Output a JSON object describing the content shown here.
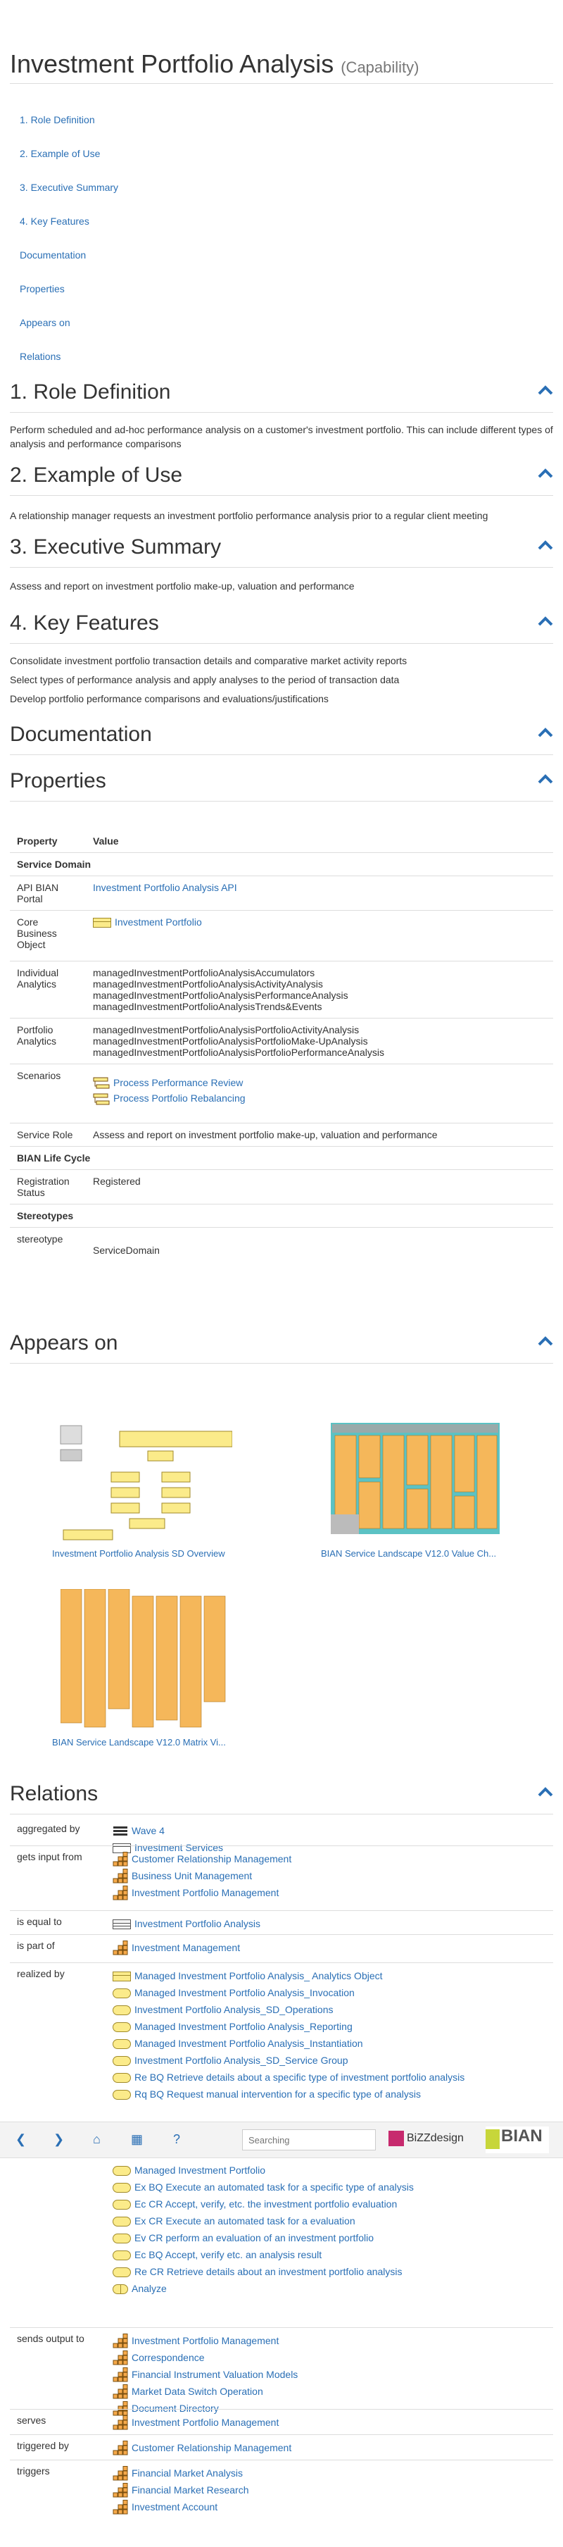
{
  "title": "Investment Portfolio Analysis",
  "title_suffix": "(Capability)",
  "toc": [
    "1. Role Definition",
    "2. Example of Use",
    "3. Executive Summary",
    "4. Key Features",
    "Documentation",
    "Properties",
    "Appears on",
    "Relations"
  ],
  "sections": {
    "role": "1. Role Definition",
    "example": "2. Example of Use",
    "exec": "3. Executive Summary",
    "features": "4. Key Features",
    "doc": "Documentation",
    "props": "Properties",
    "appears": "Appears on",
    "relations": "Relations"
  },
  "role_text": "Perform scheduled and ad-hoc performance analysis on a customer's investment portfolio. This can include different types of analysis and performance comparisons",
  "example_text": "A relationship manager requests an investment portfolio performance analysis prior to a regular client meeting",
  "exec_text": "Assess and report on investment portfolio make-up, valuation and performance",
  "features": [
    "Consolidate investment portfolio transaction details and comparative market activity reports",
    "Select types of performance analysis and apply analyses to the period of transaction data",
    "Develop portfolio performance comparisons and evaluations/justifications"
  ],
  "props": {
    "h_property": "Property",
    "h_value": "Value",
    "g_service": "Service Domain",
    "api_label": "API BIAN Portal",
    "api_value": "Investment Portfolio Analysis API",
    "cbo_label": "Core Business Object",
    "cbo_value": "Investment Portfolio",
    "ia_label": "Individual Analytics",
    "ia_values": [
      "managedInvestmentPortfolioAnalysisAccumulators",
      "managedInvestmentPortfolioAnalysisActivityAnalysis",
      "managedInvestmentPortfolioAnalysisPerformanceAnalysis",
      "managedInvestmentPortfolioAnalysisTrends&Events"
    ],
    "pa_label": "Portfolio Analytics",
    "pa_values": [
      "managedInvestmentPortfolioAnalysisPortfolioActivityAnalysis",
      "managedInvestmentPortfolioAnalysisPortfolioMake-UpAnalysis",
      "managedInvestmentPortfolioAnalysisPortfolioPerformanceAnalysis"
    ],
    "sc_label": "Scenarios",
    "sc_values": [
      "Process Performance Review",
      "Process Portfolio Rebalancing"
    ],
    "sr_label": "Service Role",
    "sr_value": "Assess and report on investment portfolio make-up, valuation and performance",
    "g_life": "BIAN Life Cycle",
    "rs_label": "Registration Status",
    "rs_value": "Registered",
    "g_stereo": "Stereotypes",
    "st_label": "stereotype",
    "st_value": "ServiceDomain"
  },
  "appears": [
    "Investment Portfolio Analysis SD Overview",
    "BIAN Service Landscape V12.0 Value Ch...",
    "BIAN Service Landscape V12.0 Matrix Vi..."
  ],
  "relations": [
    {
      "label": "aggregated by",
      "items": [
        {
          "t": "Wave 4",
          "i": "wave"
        },
        {
          "t": "Investment Services",
          "i": "plat"
        }
      ]
    },
    {
      "label": "gets input from",
      "items": [
        {
          "t": "Customer Relationship Management",
          "i": "cap"
        },
        {
          "t": "Business Unit Management",
          "i": "cap"
        },
        {
          "t": "Investment Portfolio Management",
          "i": "cap"
        }
      ]
    },
    {
      "label": "is equal to",
      "items": [
        {
          "t": "Investment Portfolio Analysis",
          "i": "table"
        }
      ]
    },
    {
      "label": "is part of",
      "items": [
        {
          "t": "Investment Management",
          "i": "cap"
        }
      ]
    },
    {
      "label": "realized by",
      "items": [
        {
          "t": "Managed Investment Portfolio Analysis_ Analytics Object",
          "i": "obj"
        },
        {
          "t": "Managed Investment Portfolio Analysis_Invocation",
          "i": "svc"
        },
        {
          "t": "Investment Portfolio Analysis_SD_Operations",
          "i": "svc"
        },
        {
          "t": "Managed Investment Portfolio Analysis_Reporting",
          "i": "svc"
        },
        {
          "t": "Managed Investment Portfolio Analysis_Instantiation",
          "i": "svc"
        },
        {
          "t": "Investment Portfolio Analysis_SD_Service Group",
          "i": "svc"
        },
        {
          "t": "Re BQ Retrieve details about a specific type of investment portfolio analysis",
          "i": "svc"
        },
        {
          "t": "Rq BQ Request manual intervention for a specific type of analysis",
          "i": "svc"
        }
      ]
    },
    {
      "label": "",
      "items": [
        {
          "t": "Managed Investment Portfolio",
          "i": "svc"
        },
        {
          "t": "Ex BQ Execute an automated task for a specific type of analysis",
          "i": "svc"
        },
        {
          "t": "Ec CR Accept, verify, etc. the investment portfolio evaluation",
          "i": "svc"
        },
        {
          "t": "Ex CR Execute an automated task for a evaluation",
          "i": "svc"
        },
        {
          "t": "Ev CR perform an evaluation of an investment portfolio",
          "i": "svc"
        },
        {
          "t": "Ec BQ Accept, verify etc. an analysis result",
          "i": "svc"
        },
        {
          "t": "Re CR Retrieve details about an investment portfolio analysis",
          "i": "svc"
        },
        {
          "t": "Analyze",
          "i": "half"
        }
      ]
    },
    {
      "label": "sends output to",
      "items": [
        {
          "t": "Investment Portfolio Management",
          "i": "cap"
        },
        {
          "t": "Correspondence",
          "i": "cap"
        },
        {
          "t": "Financial Instrument Valuation Models",
          "i": "cap"
        },
        {
          "t": "Market Data Switch Operation",
          "i": "cap"
        },
        {
          "t": "Document Directory",
          "i": "cap"
        }
      ]
    },
    {
      "label": "serves",
      "items": [
        {
          "t": "Investment Portfolio Management",
          "i": "cap"
        }
      ]
    },
    {
      "label": "triggered by",
      "items": [
        {
          "t": "Customer Relationship Management",
          "i": "cap"
        }
      ]
    },
    {
      "label": "triggers",
      "items": [
        {
          "t": "Financial Market Analysis",
          "i": "cap"
        },
        {
          "t": "Financial Market Research",
          "i": "cap"
        },
        {
          "t": "Investment Account",
          "i": "cap"
        }
      ]
    }
  ],
  "toolbar": {
    "search_placeholder": "Searching",
    "bizz": "BiZZdesign",
    "bian": "BIAN"
  }
}
